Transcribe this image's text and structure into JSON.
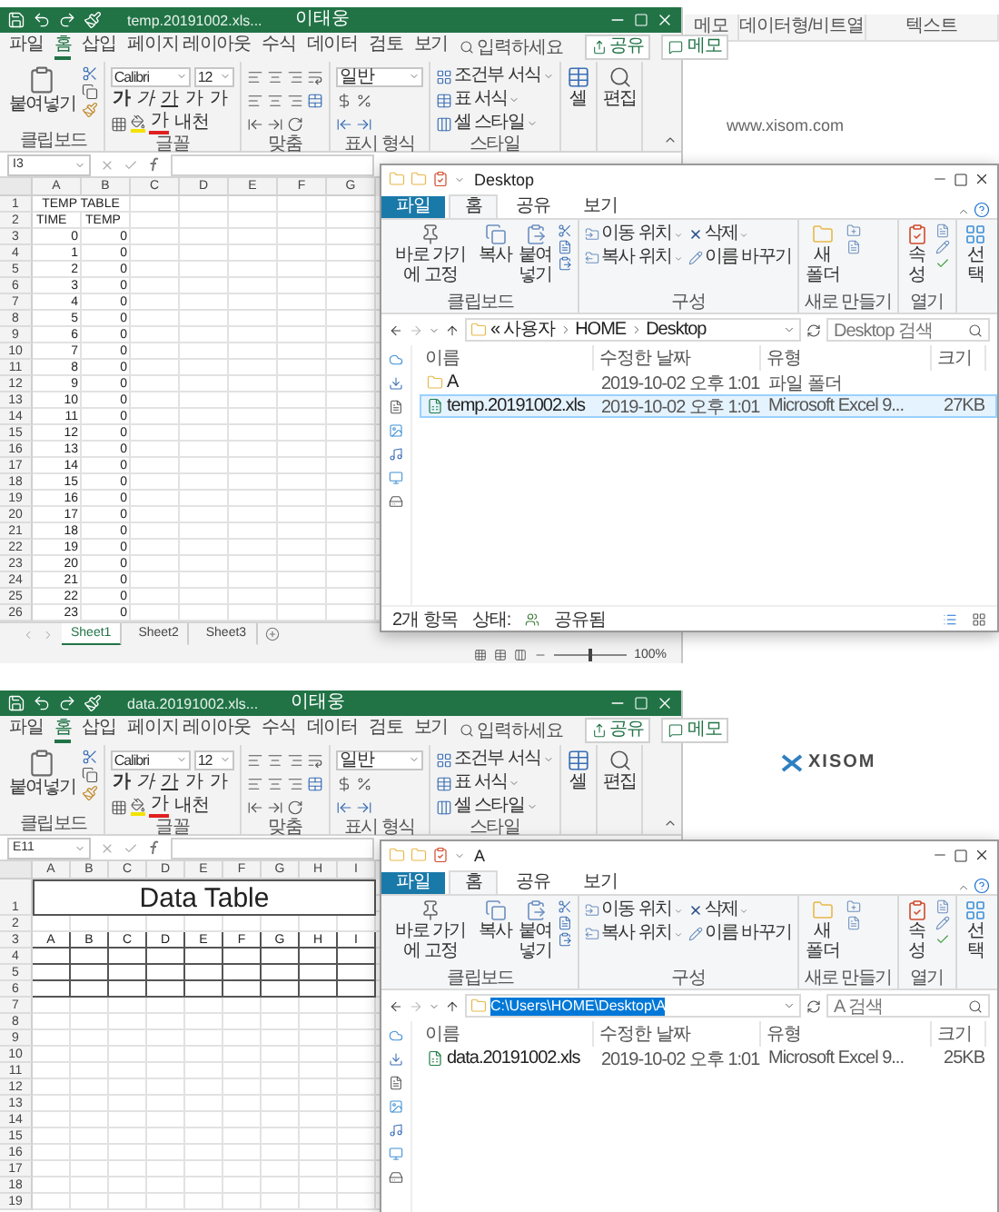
{
  "screens": [
    {
      "side": {
        "header_cells": [
          "메모",
          "데이터형/비트열",
          "텍스트"
        ],
        "site": "www.xisom.com"
      },
      "excel": {
        "title": "temp.20191002.xls...",
        "user": "이태웅",
        "tabs": [
          {
            "label": "파일",
            "selected": false
          },
          {
            "label": "홈",
            "selected": true
          },
          {
            "label": "삽입",
            "selected": false
          },
          {
            "label": "페이지 레이아웃",
            "selected": false
          },
          {
            "label": "수식",
            "selected": false
          },
          {
            "label": "데이터",
            "selected": false
          },
          {
            "label": "검토",
            "selected": false
          },
          {
            "label": "보기",
            "selected": false
          }
        ],
        "search": "입력하세요",
        "share": "공유",
        "memo": "메모",
        "ribbon": {
          "paste": "붙여넣기",
          "clipboard": "클립보드",
          "font_name": "Calibri",
          "font_size": "12",
          "bold": "가",
          "italic": "가",
          "underline": "가",
          "grow": "가",
          "shrink": "가",
          "font_color": "가",
          "phonetic": "내천",
          "font": "글꼴",
          "align": "맞춤",
          "number_format": "일반",
          "number": "표시 형식",
          "style_items": [
            "조건부 서식",
            "표 서식",
            "셀 스타일"
          ],
          "styles": "스타일",
          "cells": "셀",
          "editing": "편집"
        },
        "name_box": "I3",
        "columns": [
          "A",
          "B",
          "C",
          "D",
          "E",
          "F",
          "G"
        ],
        "rows": [
          {
            "header": "1",
            "kind": "merged",
            "text": "TEMP TABLE"
          },
          {
            "header": "2",
            "kind": "labels",
            "cells": [
              "TIME",
              "TEMP"
            ]
          },
          {
            "header": "3",
            "kind": "numbers",
            "cells": [
              "0",
              "0"
            ]
          },
          {
            "header": "4",
            "kind": "numbers",
            "cells": [
              "1",
              "0"
            ]
          },
          {
            "header": "5",
            "kind": "numbers",
            "cells": [
              "2",
              "0"
            ]
          },
          {
            "header": "6",
            "kind": "numbers",
            "cells": [
              "3",
              "0"
            ]
          },
          {
            "header": "7",
            "kind": "numbers",
            "cells": [
              "4",
              "0"
            ]
          },
          {
            "header": "8",
            "kind": "numbers",
            "cells": [
              "5",
              "0"
            ]
          },
          {
            "header": "9",
            "kind": "numbers",
            "cells": [
              "6",
              "0"
            ]
          },
          {
            "header": "10",
            "kind": "numbers",
            "cells": [
              "7",
              "0"
            ]
          },
          {
            "header": "11",
            "kind": "numbers",
            "cells": [
              "8",
              "0"
            ]
          },
          {
            "header": "12",
            "kind": "numbers",
            "cells": [
              "9",
              "0"
            ]
          },
          {
            "header": "13",
            "kind": "numbers",
            "cells": [
              "10",
              "0"
            ]
          },
          {
            "header": "14",
            "kind": "numbers",
            "cells": [
              "11",
              "0"
            ]
          },
          {
            "header": "15",
            "kind": "numbers",
            "cells": [
              "12",
              "0"
            ]
          },
          {
            "header": "16",
            "kind": "numbers",
            "cells": [
              "13",
              "0"
            ]
          },
          {
            "header": "17",
            "kind": "numbers",
            "cells": [
              "14",
              "0"
            ]
          },
          {
            "header": "18",
            "kind": "numbers",
            "cells": [
              "15",
              "0"
            ]
          },
          {
            "header": "19",
            "kind": "numbers",
            "cells": [
              "16",
              "0"
            ]
          },
          {
            "header": "20",
            "kind": "numbers",
            "cells": [
              "17",
              "0"
            ]
          },
          {
            "header": "21",
            "kind": "numbers",
            "cells": [
              "18",
              "0"
            ]
          },
          {
            "header": "22",
            "kind": "numbers",
            "cells": [
              "19",
              "0"
            ]
          },
          {
            "header": "23",
            "kind": "numbers",
            "cells": [
              "20",
              "0"
            ]
          },
          {
            "header": "24",
            "kind": "numbers",
            "cells": [
              "21",
              "0"
            ]
          },
          {
            "header": "25",
            "kind": "numbers",
            "cells": [
              "22",
              "0"
            ]
          },
          {
            "header": "26",
            "kind": "numbers",
            "cells": [
              "23",
              "0"
            ]
          }
        ],
        "sheets": [
          {
            "label": "Sheet1",
            "selected": true
          },
          {
            "label": "Sheet2",
            "selected": false
          },
          {
            "label": "Sheet3",
            "selected": false
          }
        ],
        "zoom": {
          "text": "100%",
          "level": 0.5
        }
      },
      "explorer": {
        "title": "Desktop",
        "tabs": [
          {
            "label": "파일",
            "kind": "file",
            "selected": false
          },
          {
            "label": "홈",
            "kind": "tab",
            "selected": true
          },
          {
            "label": "공유",
            "kind": "tab",
            "selected": false
          },
          {
            "label": "보기",
            "kind": "tab",
            "selected": false
          }
        ],
        "ribbon": {
          "pin": "바로 가기에 고정",
          "copy": "복사",
          "paste": "붙여넣기",
          "clipboard": "클립보드",
          "move": "이동 위치",
          "copy_to": "복사 위치",
          "delete": "삭제",
          "rename": "이름 바꾸기",
          "organize": "구성",
          "new_folder": "새 폴더",
          "new": "새로 만들기",
          "properties": "속성",
          "open": "열기",
          "select": "선택"
        },
        "address": {
          "kind": "breadcrumb",
          "prefix": "«",
          "parts": [
            "사용자",
            "HOME",
            "Desktop"
          ]
        },
        "search": "Desktop 검색",
        "columns": [
          "이름",
          "수정한 날짜",
          "유형",
          "크기"
        ],
        "files": [
          {
            "name": "A",
            "modified": "2019-10-02 오후 1:01",
            "type": "파일 폴더",
            "kind": "folder",
            "selected": false
          },
          {
            "name": "temp.20191002.xls",
            "modified": "2019-10-02 오후 1:01",
            "type": "Microsoft Excel 9...",
            "size": "27KB",
            "kind": "excel",
            "selected": true
          }
        ],
        "status": {
          "count": "2개 항목",
          "state_label": "상태:",
          "state": "공유됨"
        }
      }
    },
    {
      "side": {
        "logo": "XISOM"
      },
      "excel": {
        "title": "data.20191002.xls...",
        "user": "이태웅",
        "tabs": [
          {
            "label": "파일",
            "selected": false
          },
          {
            "label": "홈",
            "selected": true
          },
          {
            "label": "삽입",
            "selected": false
          },
          {
            "label": "페이지 레이아웃",
            "selected": false
          },
          {
            "label": "수식",
            "selected": false
          },
          {
            "label": "데이터",
            "selected": false
          },
          {
            "label": "검토",
            "selected": false
          },
          {
            "label": "보기",
            "selected": false
          }
        ],
        "search": "입력하세요",
        "share": "공유",
        "memo": "메모",
        "ribbon": {
          "paste": "붙여넣기",
          "clipboard": "클립보드",
          "font_name": "Calibri",
          "font_size": "12",
          "bold": "가",
          "italic": "가",
          "underline": "가",
          "grow": "가",
          "shrink": "가",
          "font_color": "가",
          "phonetic": "내천",
          "font": "글꼴",
          "align": "맞춤",
          "number_format": "일반",
          "number": "표시 형식",
          "style_items": [
            "조건부 서식",
            "표 서식",
            "셀 스타일"
          ],
          "styles": "스타일",
          "cells": "셀",
          "editing": "편집"
        },
        "name_box": "E11",
        "columns": [
          "A",
          "B",
          "C",
          "D",
          "E",
          "F",
          "G",
          "H",
          "I"
        ],
        "rows": [
          {
            "header": "1",
            "kind": "title",
            "text": "Data Table"
          },
          {
            "header": "2",
            "kind": "blank"
          },
          {
            "header": "3",
            "kind": "boxed",
            "cells": [
              "A",
              "B",
              "C",
              "D",
              "E",
              "F",
              "G",
              "H",
              "I"
            ]
          },
          {
            "header": "4",
            "kind": "boxed"
          },
          {
            "header": "5",
            "kind": "boxed"
          },
          {
            "header": "6",
            "kind": "boxed"
          },
          {
            "header": "7",
            "kind": "blank"
          },
          {
            "header": "8",
            "kind": "blank"
          },
          {
            "header": "9",
            "kind": "blank"
          },
          {
            "header": "10",
            "kind": "blank"
          },
          {
            "header": "11",
            "kind": "blank"
          },
          {
            "header": "12",
            "kind": "blank"
          },
          {
            "header": "13",
            "kind": "blank"
          },
          {
            "header": "14",
            "kind": "blank"
          },
          {
            "header": "15",
            "kind": "blank"
          },
          {
            "header": "16",
            "kind": "blank"
          },
          {
            "header": "17",
            "kind": "blank"
          },
          {
            "header": "18",
            "kind": "blank"
          },
          {
            "header": "19",
            "kind": "blank"
          }
        ]
      },
      "explorer": {
        "title": "A",
        "tabs": [
          {
            "label": "파일",
            "kind": "file",
            "selected": false
          },
          {
            "label": "홈",
            "kind": "tab",
            "selected": true
          },
          {
            "label": "공유",
            "kind": "tab",
            "selected": false
          },
          {
            "label": "보기",
            "kind": "tab",
            "selected": false
          }
        ],
        "ribbon": {
          "pin": "바로 가기에 고정",
          "copy": "복사",
          "paste": "붙여넣기",
          "clipboard": "클립보드",
          "move": "이동 위치",
          "copy_to": "복사 위치",
          "delete": "삭제",
          "rename": "이름 바꾸기",
          "organize": "구성",
          "new_folder": "새 폴더",
          "new": "새로 만들기",
          "properties": "속성",
          "open": "열기",
          "select": "선택"
        },
        "address": {
          "kind": "path",
          "text": "C:\\Users\\HOME\\Desktop\\A",
          "selected": true
        },
        "search": "A 검색",
        "columns": [
          "이름",
          "수정한 날짜",
          "유형",
          "크기"
        ],
        "files": [
          {
            "name": "data.20191002.xls",
            "modified": "2019-10-02 오후 1:01",
            "type": "Microsoft Excel 9...",
            "size": "25KB",
            "kind": "excel",
            "selected": false
          }
        ]
      }
    }
  ]
}
